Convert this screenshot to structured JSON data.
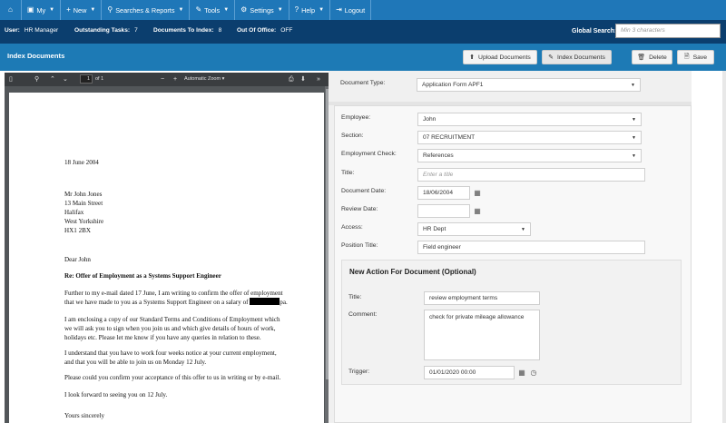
{
  "topnav": {
    "items": [
      {
        "icon": "home-icon",
        "glyph": "⌂",
        "label": "",
        "caret": false
      },
      {
        "icon": "folder-icon",
        "glyph": "▣",
        "label": "My",
        "caret": true
      },
      {
        "icon": "plus-icon",
        "glyph": "+",
        "label": "New",
        "caret": true
      },
      {
        "icon": "search-icon",
        "glyph": "⚲",
        "label": "Searches & Reports",
        "caret": true
      },
      {
        "icon": "wrench-icon",
        "glyph": "✎",
        "label": "Tools",
        "caret": true
      },
      {
        "icon": "gear-icon",
        "glyph": "⚙",
        "label": "Settings",
        "caret": true
      },
      {
        "icon": "help-icon",
        "glyph": "?",
        "label": "Help",
        "caret": true
      },
      {
        "icon": "logout-icon",
        "glyph": "⇥",
        "label": "Logout",
        "caret": false
      }
    ]
  },
  "status": {
    "user_label": "User:",
    "user_value": "HR Manager",
    "tasks_label": "Outstanding Tasks:",
    "tasks_value": "7",
    "docs_label": "Documents To Index:",
    "docs_value": "8",
    "ooo_label": "Out Of Office:",
    "ooo_value": "OFF",
    "global_search_label": "Global Search:",
    "global_search_placeholder": "Min 3 characters"
  },
  "section": {
    "title": "Index Documents",
    "upload_label": "Upload Documents",
    "index_label": "Index Documents",
    "delete_label": "Delete",
    "save_label": "Save"
  },
  "pdf": {
    "page_number": "1",
    "page_count": "of 1",
    "zoom_label": "Automatic Zoom",
    "zoom_out": "−",
    "zoom_in": "+",
    "letter": {
      "date": "18 June 2004",
      "address": [
        "Mr John Jones",
        "13 Main Street",
        "Halifax",
        "West Yorkshire",
        "HX1 2BX"
      ],
      "salutation": "Dear John",
      "subject": "Re:  Offer of Employment as a Systems Support Engineer",
      "p1_line1": "Further to my e-mail dated 17 June, I am writing to confirm the offer of employment",
      "p1_line2": "that we have made to you as a Systems Support Engineer on a salary of",
      "p1_line2_end": "pa.",
      "p2": [
        "I am enclosing a copy of our Standard Terms and Conditions of Employment which",
        "we will ask you to sign when you join us and which give details of hours of work,",
        "holidays etc. Please let me know if you have any queries in relation to these."
      ],
      "p3": [
        "I understand that you have to work four weeks notice at your current employment,",
        "and that you will be able to join us on Monday 12 July."
      ],
      "p4": "Please could you confirm your acceptance of this offer to us in writing or by e-mail.",
      "p5": "I look forward to seeing you on 12 July.",
      "closing": "Yours sincerely"
    }
  },
  "form": {
    "document_type_label": "Document Type:",
    "document_type_value": "Application Form APF1",
    "employee_label": "Employee:",
    "employee_value": "John",
    "section_label": "Section:",
    "section_value": "07 RECRUITMENT",
    "employment_check_label": "Employment Check:",
    "employment_check_value": "References",
    "title_label": "Title:",
    "title_placeholder": "Enter a title",
    "document_date_label": "Document Date:",
    "document_date_value": "18/06/2004",
    "review_date_label": "Review Date:",
    "review_date_value": "",
    "access_label": "Access:",
    "access_value": "HR Dept",
    "position_title_label": "Position Title:",
    "position_title_value": "Field engineer"
  },
  "action": {
    "heading": "New Action For Document (Optional)",
    "title_label": "Title:",
    "title_value": "review employment terms",
    "comment_label": "Comment:",
    "comment_value": "check for private mileage allowance",
    "trigger_label": "Trigger:",
    "trigger_value": "01/01/2020 00:00"
  }
}
